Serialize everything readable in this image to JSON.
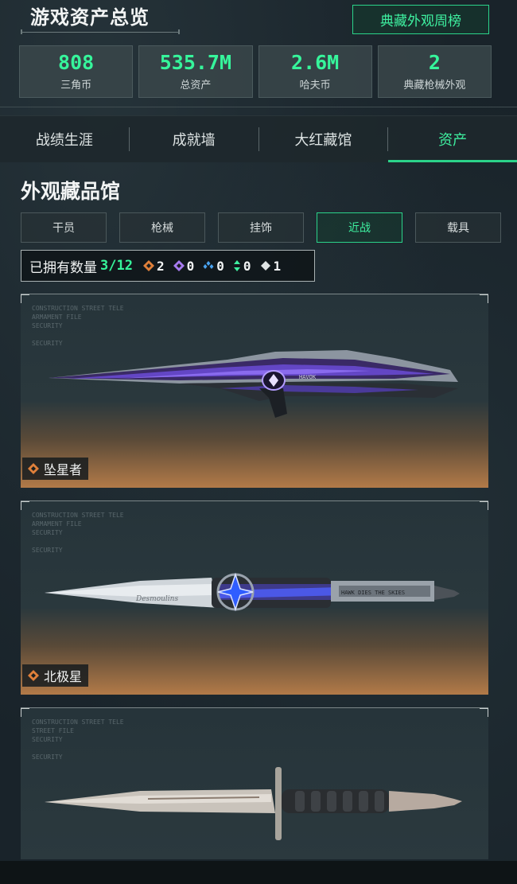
{
  "header": {
    "title": "游戏资产总览",
    "rank_button": "典藏外观周榜",
    "stats": [
      {
        "value": "808",
        "label": "三角币"
      },
      {
        "value": "535.7M",
        "label": "总资产"
      },
      {
        "value": "2.6M",
        "label": "哈夫币"
      },
      {
        "value": "2",
        "label": "典藏枪械外观"
      }
    ]
  },
  "tabs": [
    {
      "label": "战绩生涯"
    },
    {
      "label": "成就墙"
    },
    {
      "label": "大红藏馆"
    },
    {
      "label": "资产",
      "active": true
    }
  ],
  "section": {
    "title": "外观藏品馆",
    "filters": [
      {
        "label": "干员"
      },
      {
        "label": "枪械"
      },
      {
        "label": "挂饰"
      },
      {
        "label": "近战",
        "active": true
      },
      {
        "label": "载具"
      }
    ],
    "owned_label": "已拥有数量",
    "owned_value": "3/12",
    "rarity_counts": [
      {
        "icon": "orange-diamond-icon",
        "color": "#e0803a",
        "count": "2"
      },
      {
        "icon": "purple-diamond-icon",
        "color": "#a77bf0",
        "count": "0"
      },
      {
        "icon": "blue-diamond-icon",
        "color": "#4aa3f0",
        "count": "0"
      },
      {
        "icon": "green-arrows-icon",
        "color": "#3ef0a0",
        "count": "0"
      },
      {
        "icon": "white-diamond-icon",
        "color": "#dfe4e4",
        "count": "1"
      }
    ]
  },
  "cards": [
    {
      "name": "坠星者",
      "rarity_color": "#e0803a",
      "weapon_inscription": "HAVOK"
    },
    {
      "name": "北极星",
      "rarity_color": "#e0803a",
      "weapon_inscription": "Desmoulins",
      "blade_text": "HAWK DIES THE SKIES"
    },
    {
      "name": "",
      "rarity_color": "#dfe4e4"
    }
  ],
  "colors": {
    "accent": "#2bd38a",
    "accent_text": "#3ef0a0",
    "background": "#1a2428"
  }
}
